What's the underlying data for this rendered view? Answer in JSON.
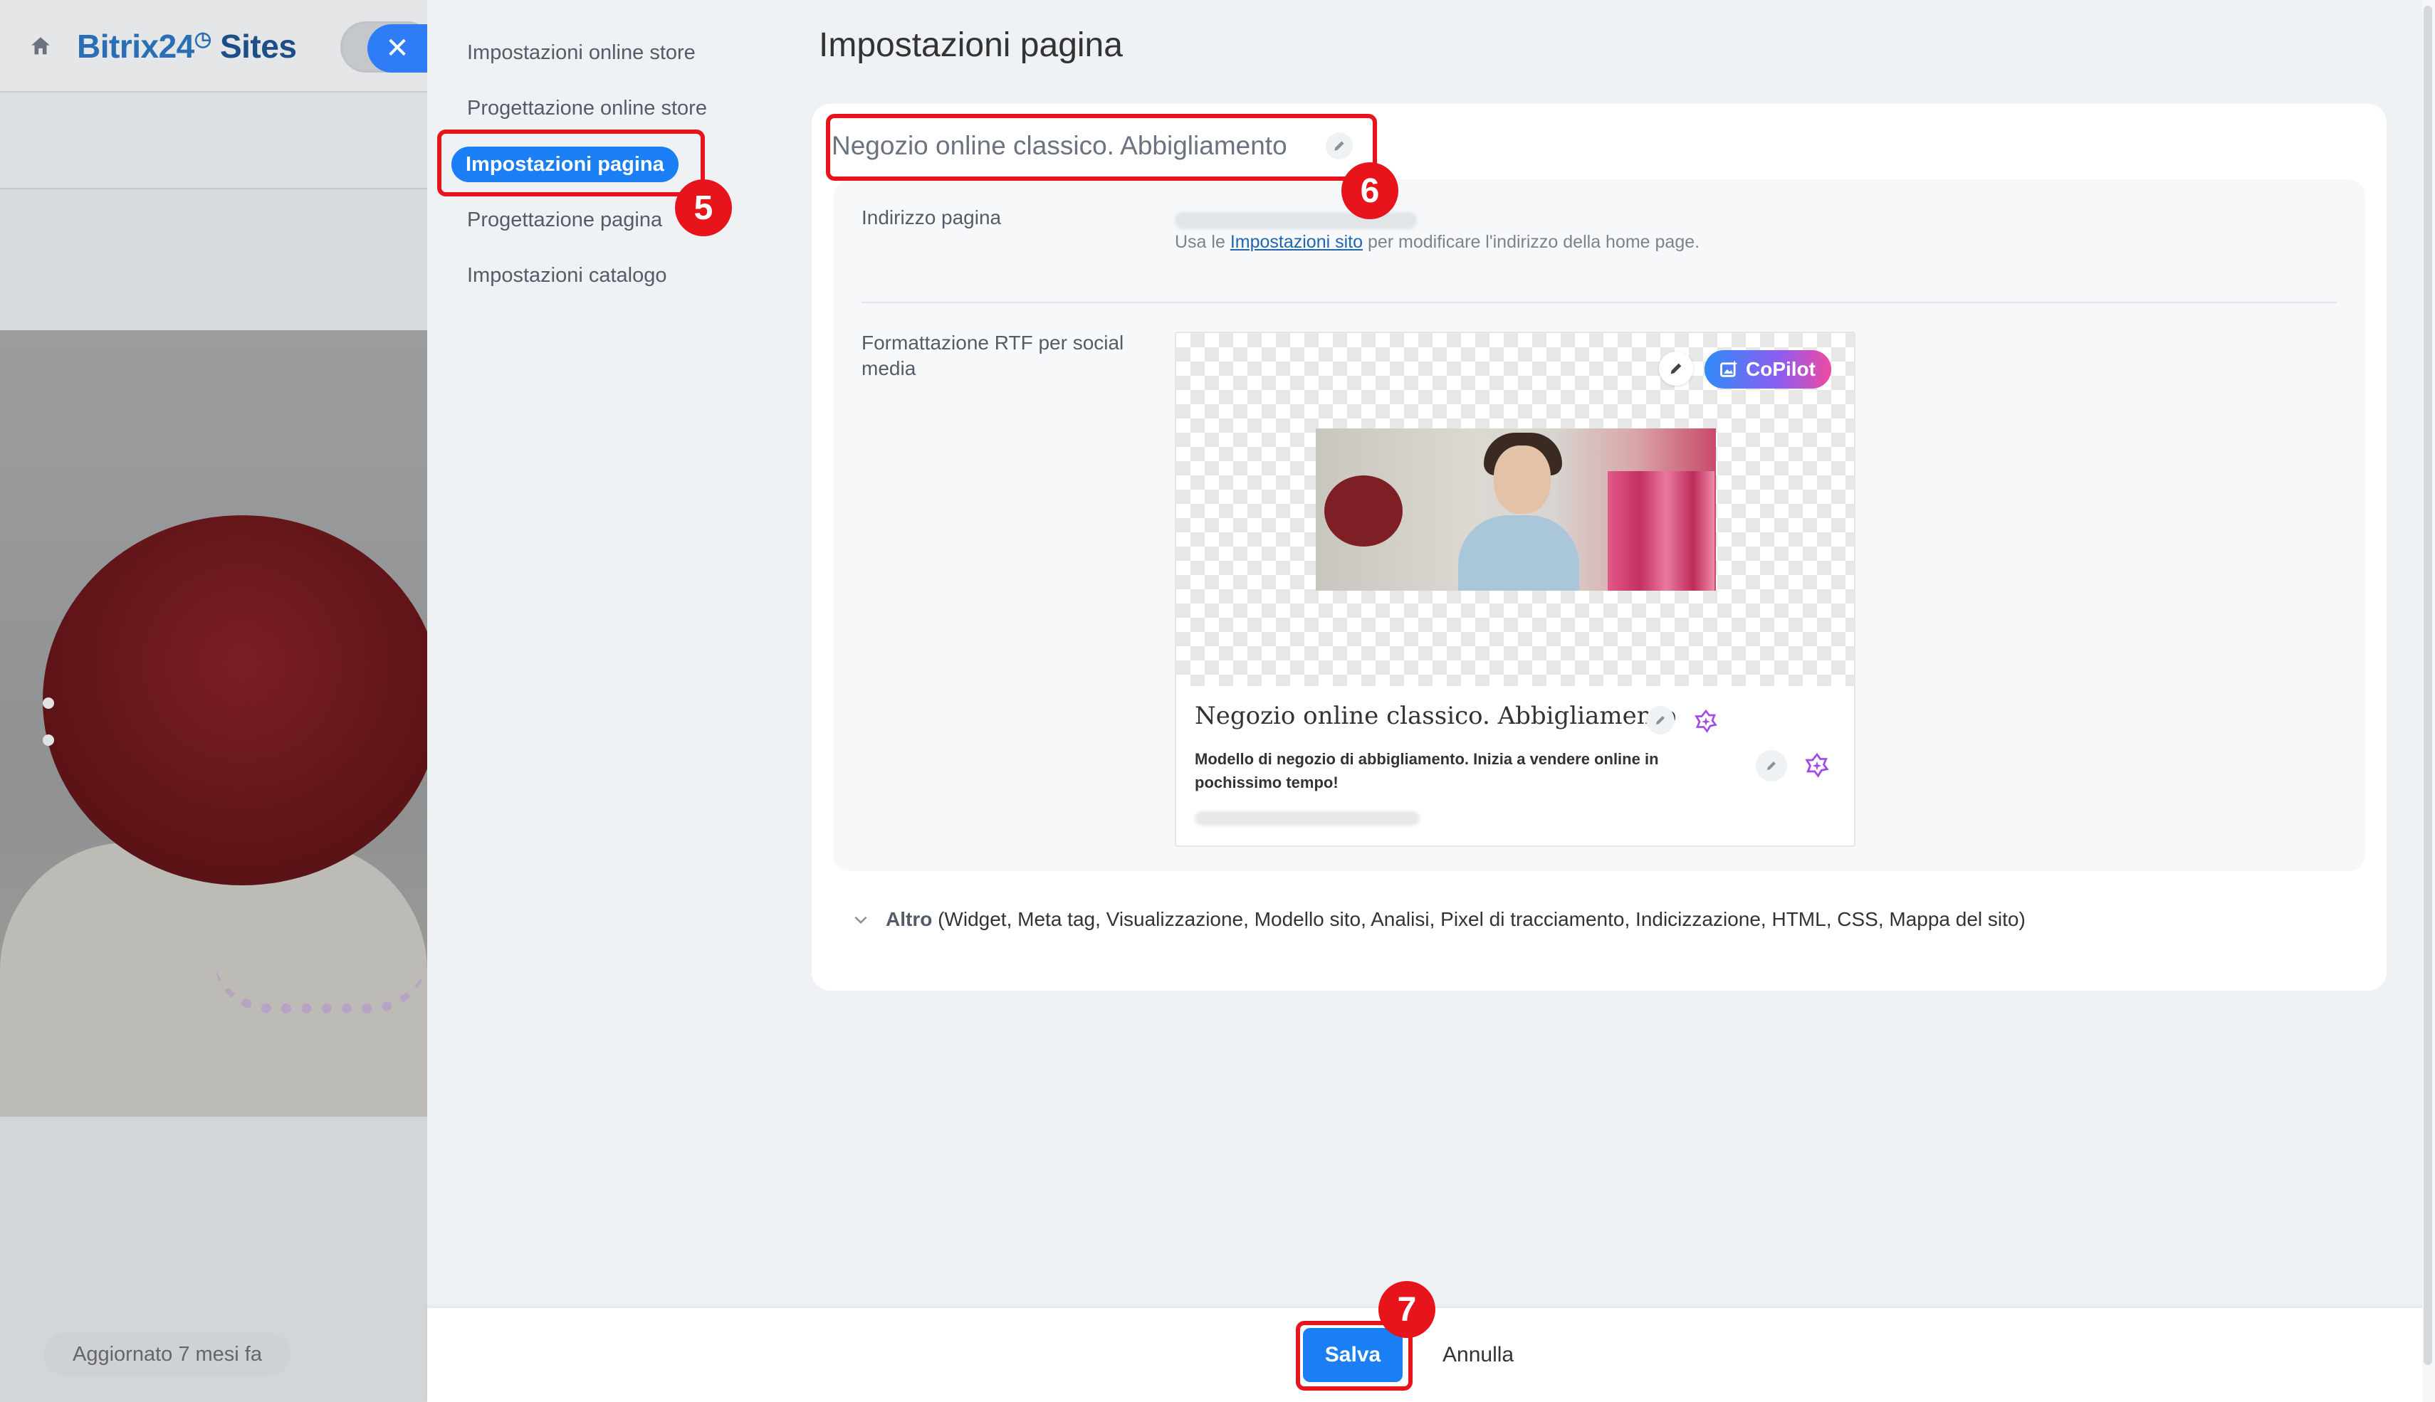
{
  "app": {
    "logo_main": "Bitrix24",
    "logo_mark": "◷",
    "logo_sites": "Sites",
    "updated": "Aggiornato 7 mesi fa",
    "close_glyph": "✕"
  },
  "nav": {
    "items": [
      {
        "label": "Impostazioni online store"
      },
      {
        "label": "Progettazione online store"
      },
      {
        "label": "Impostazioni pagina"
      },
      {
        "label": "Progettazione pagina"
      },
      {
        "label": "Impostazioni catalogo"
      }
    ],
    "active_index": 2
  },
  "page": {
    "title": "Impostazioni pagina",
    "name_value": "Negozio online classico. Abbigliamento"
  },
  "address": {
    "label": "Indirizzo pagina",
    "hint_prefix": "Usa le ",
    "hint_link": "Impostazioni sito",
    "hint_suffix": " per modificare l'indirizzo della home page."
  },
  "social": {
    "label": "Formattazione RTF per social media",
    "copilot_label": "CoPilot",
    "preview_title": "Negozio online classico. Abbigliamento",
    "preview_description": "Modello di negozio di abbigliamento. Inizia a vendere online in pochissimo tempo!"
  },
  "more": {
    "label": "Altro",
    "items": "(Widget,  Meta tag,  Visualizzazione,  Modello sito,  Analisi,  Pixel di tracciamento,  Indicizzazione,  HTML,  CSS,  Mappa del sito)"
  },
  "footer": {
    "save_label": "Salva",
    "cancel_label": "Annulla"
  },
  "annotations": {
    "step5": "5",
    "step6": "6",
    "step7": "7",
    "color": "#e8141c"
  },
  "colors": {
    "accent": "#1a7ef5",
    "copilot_gradient": [
      "#2f8bf5",
      "#8f5cf0",
      "#ef4aa0"
    ]
  }
}
